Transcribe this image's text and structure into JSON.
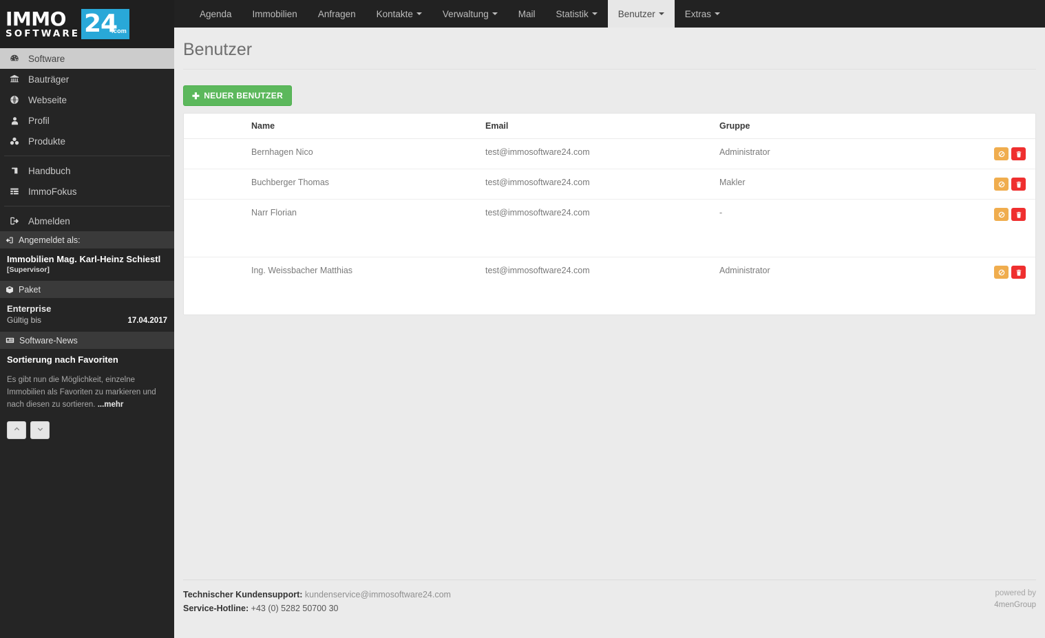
{
  "brand": {
    "logo_immo": "IMMO",
    "logo_software": "SOFTWARE",
    "logo_24": "24",
    "logo_com": ".com",
    "accent_color": "#29a8d8"
  },
  "topnav": {
    "items": [
      {
        "label": "Agenda",
        "caret": false,
        "active": false
      },
      {
        "label": "Immobilien",
        "caret": false,
        "active": false
      },
      {
        "label": "Anfragen",
        "caret": false,
        "active": false
      },
      {
        "label": "Kontakte",
        "caret": true,
        "active": false
      },
      {
        "label": "Verwaltung",
        "caret": true,
        "active": false
      },
      {
        "label": "Mail",
        "caret": false,
        "active": false
      },
      {
        "label": "Statistik",
        "caret": true,
        "active": false
      },
      {
        "label": "Benutzer",
        "caret": true,
        "active": true
      },
      {
        "label": "Extras",
        "caret": true,
        "active": false
      }
    ]
  },
  "sidebar": {
    "items": [
      {
        "label": "Software",
        "icon": "dashboard-icon",
        "active": true
      },
      {
        "label": "Bauträger",
        "icon": "bank-icon",
        "active": false
      },
      {
        "label": "Webseite",
        "icon": "globe-icon",
        "active": false
      },
      {
        "label": "Profil",
        "icon": "user-icon",
        "active": false
      },
      {
        "label": "Produkte",
        "icon": "cubes-icon",
        "active": false
      },
      {
        "label": "Handbuch",
        "icon": "book-icon",
        "active": false
      },
      {
        "label": "ImmoFokus",
        "icon": "list-icon",
        "active": false
      },
      {
        "label": "Abmelden",
        "icon": "signout-icon",
        "active": false
      }
    ],
    "logged_in": {
      "header": "Angemeldet als:",
      "name": "Immobilien Mag. Karl-Heinz Schiestl",
      "role": "[Supervisor]"
    },
    "paket": {
      "header": "Paket",
      "name": "Enterprise",
      "valid_label": "Gültig bis",
      "valid_date": "17.04.2017"
    },
    "news": {
      "header": "Software-News",
      "title": "Sortierung nach Favoriten",
      "text": "Es gibt nun die Möglichkeit, einzelne Immobilien als Favoriten zu markieren und nach diesen zu sortieren. ",
      "more": "...mehr",
      "prev_icon": "chevron-up-icon",
      "next_icon": "chevron-down-icon"
    }
  },
  "page": {
    "title": "Benutzer",
    "new_button": "NEUER BENUTZER",
    "new_button_icon": "plus-icon"
  },
  "table": {
    "columns": [
      "",
      "Name",
      "Email",
      "Gruppe",
      ""
    ],
    "rows": [
      {
        "name": "Bernhagen Nico",
        "email": "test@immosoftware24.com",
        "gruppe": "Administrator",
        "tall": false
      },
      {
        "name": "Buchberger Thomas",
        "email": "test@immosoftware24.com",
        "gruppe": "Makler",
        "tall": false
      },
      {
        "name": "Narr Florian",
        "email": "test@immosoftware24.com",
        "gruppe": "-",
        "tall": true
      },
      {
        "name": "Ing. Weissbacher Matthias",
        "email": "test@immosoftware24.com",
        "gruppe": "Administrator",
        "tall": true
      }
    ],
    "row_actions": {
      "ban_icon": "ban-icon",
      "delete_icon": "trash-icon",
      "ban_color": "#f0ad4e",
      "delete_color": "#ef2f2f"
    }
  },
  "footer": {
    "support_label": "Technischer Kundensupport:",
    "support_email": "kundenservice@immosoftware24.com",
    "hotline_label": "Service-Hotline:",
    "hotline_value": "+43 (0) 5282 50700 30",
    "powered_by": "powered by",
    "powered_brand": "4menGroup"
  }
}
